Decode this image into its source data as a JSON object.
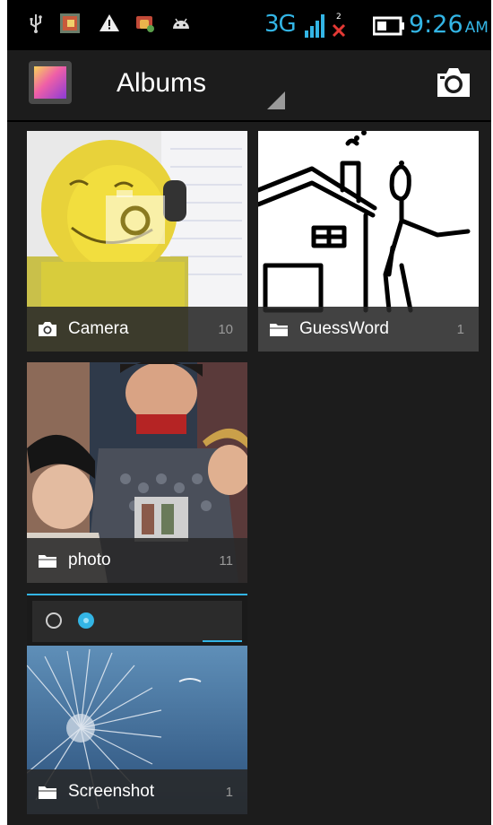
{
  "status_bar": {
    "network": "3G",
    "time": "9:26",
    "ampm": "AM",
    "icons": [
      "usb-icon",
      "gallery-notification-icon",
      "warning-icon",
      "app-notification-icon",
      "android-icon",
      "signal-icon",
      "no-data-icon",
      "battery-icon"
    ]
  },
  "action_bar": {
    "title": "Albums",
    "camera_icon": "camera-icon"
  },
  "albums": [
    {
      "name": "Camera",
      "count": "10",
      "icon": "camera-icon"
    },
    {
      "name": "GuessWord",
      "count": "1",
      "icon": "folder-icon"
    },
    {
      "name": "photo",
      "count": "11",
      "icon": "folder-icon"
    },
    {
      "name": "Screenshot",
      "count": "1",
      "icon": "folder-icon"
    }
  ],
  "colors": {
    "accent": "#33b5e5",
    "background": "#1c1c1c",
    "status_bar": "#000000",
    "label_bar": "#282828",
    "count_text": "#9a9a9a"
  }
}
